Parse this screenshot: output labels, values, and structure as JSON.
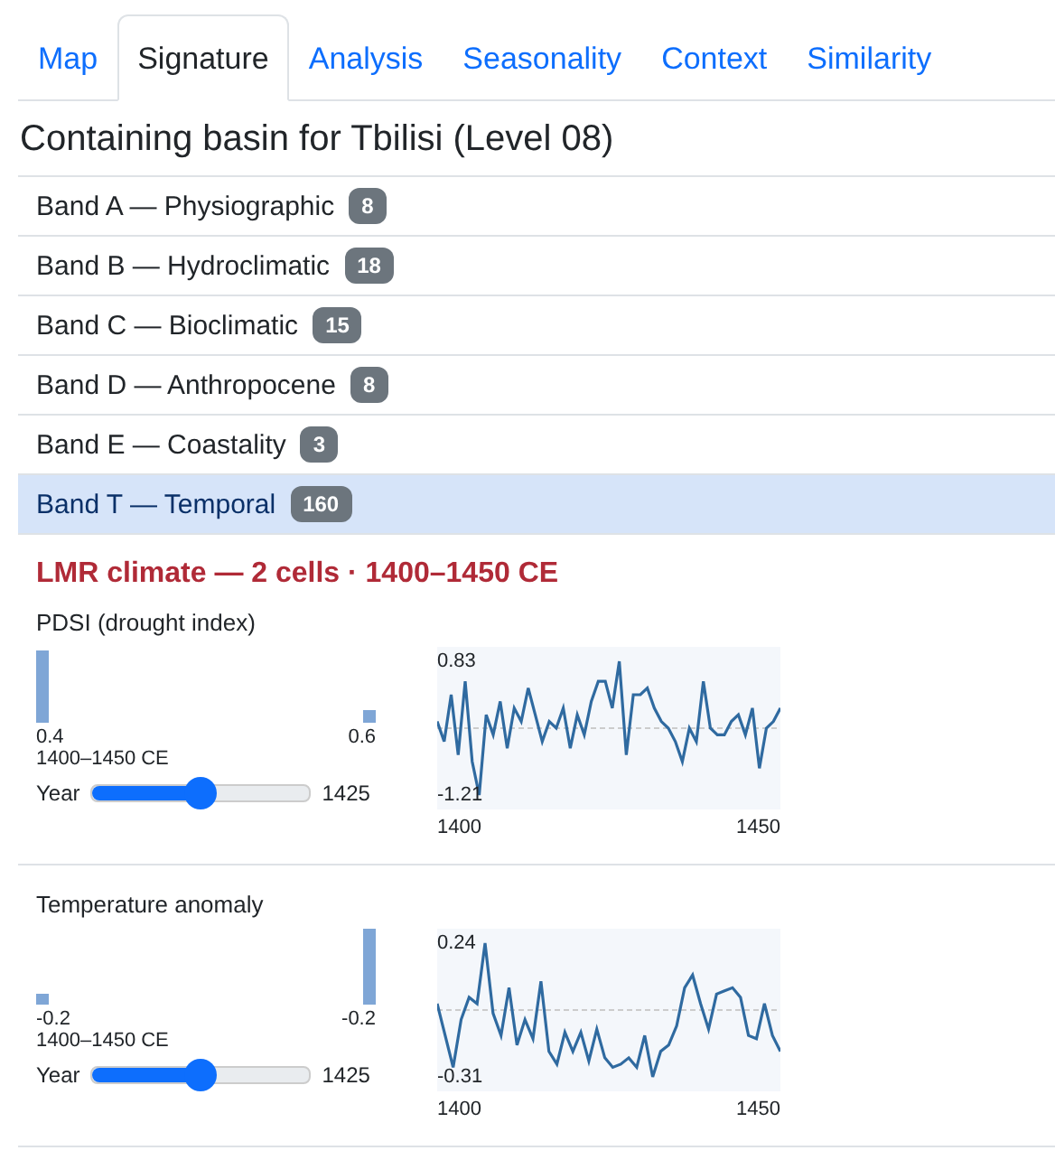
{
  "tabs": [
    {
      "label": "Map",
      "selected": false
    },
    {
      "label": "Signature",
      "selected": true
    },
    {
      "label": "Analysis",
      "selected": false
    },
    {
      "label": "Seasonality",
      "selected": false
    },
    {
      "label": "Context",
      "selected": false
    },
    {
      "label": "Similarity",
      "selected": false
    }
  ],
  "title": "Containing basin for Tbilisi (Level 08)",
  "bands": [
    {
      "label": "Band A — Physiographic",
      "count": "8",
      "selected": false
    },
    {
      "label": "Band B — Hydroclimatic",
      "count": "18",
      "selected": false
    },
    {
      "label": "Band C — Bioclimatic",
      "count": "15",
      "selected": false
    },
    {
      "label": "Band D — Anthropocene",
      "count": "8",
      "selected": false
    },
    {
      "label": "Band E — Coastality",
      "count": "3",
      "selected": false
    },
    {
      "label": "Band T — Temporal",
      "count": "160",
      "selected": true
    }
  ],
  "section_heading": "LMR climate — 2 cells · 1400–1450 CE",
  "variables": [
    {
      "name": "PDSI (drought index)",
      "cells": [
        {
          "value": "0.4"
        },
        {
          "value": "0.6"
        }
      ],
      "range": "1400–1450 CE",
      "slider": {
        "label": "Year",
        "level": 0.5,
        "value": "1425"
      },
      "sparkline": {
        "max": "0.83",
        "min": "-1.21",
        "x_start": "1400",
        "x_end": "1450"
      }
    },
    {
      "name": "Temperature anomaly",
      "cells": [
        {
          "value": "-0.2"
        },
        {
          "value": "-0.2"
        }
      ],
      "range": "1400–1450 CE",
      "slider": {
        "label": "Year",
        "level": 0.5,
        "value": "1425"
      },
      "sparkline": {
        "max": "0.24",
        "min": "-0.31",
        "x_start": "1400",
        "x_end": "1450"
      }
    }
  ]
}
